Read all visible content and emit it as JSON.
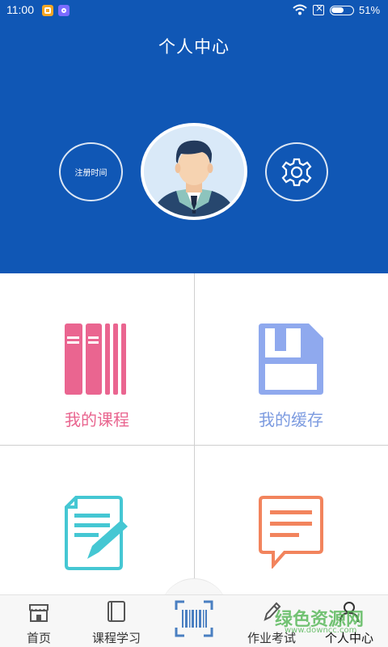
{
  "status_bar": {
    "time": "11:00",
    "battery_percent": "51%",
    "battery_level": 0.51
  },
  "header": {
    "title": "个人中心",
    "register_time_label": "注册时间",
    "background_color": "#1057b5"
  },
  "menu": {
    "my_courses": {
      "label": "我的课程",
      "color": "#e9658f",
      "icon": "books-icon"
    },
    "my_cache": {
      "label": "我的缓存",
      "color": "#7c9be0",
      "icon": "save-disk-icon"
    },
    "notes": {
      "label": "",
      "color": "#45c7d3",
      "icon": "note-edit-icon"
    },
    "messages": {
      "label": "",
      "color": "#f2845d",
      "icon": "message-icon"
    }
  },
  "tabbar": {
    "items": [
      {
        "label": "首页",
        "icon": "store-icon"
      },
      {
        "label": "课程学习",
        "icon": "book-icon"
      },
      {
        "label": "",
        "icon": "barcode-scan-icon"
      },
      {
        "label": "作业考试",
        "icon": "pencil-icon"
      },
      {
        "label": "个人中心",
        "icon": "person-icon"
      }
    ]
  },
  "watermark": {
    "text": "绿色资源网",
    "url": "www.downcc.com"
  }
}
